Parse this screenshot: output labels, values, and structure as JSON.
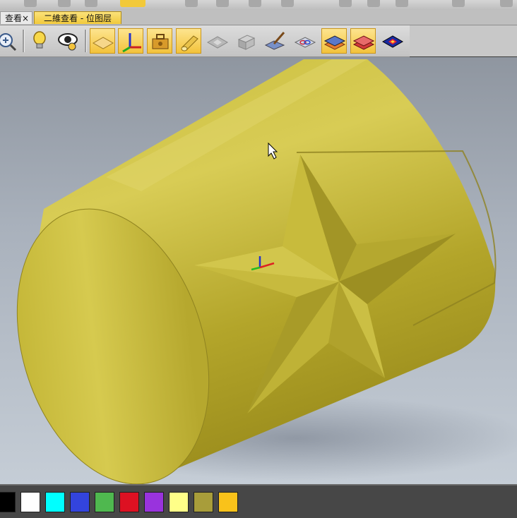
{
  "tabs": [
    {
      "label": "查看",
      "close": "×",
      "active": false
    },
    {
      "label": "二維查看 - 位图层",
      "active": true
    }
  ],
  "toolbar": {
    "icons": [
      {
        "name": "zoom-icon",
        "active": false
      },
      {
        "name": "lightbulb-icon",
        "active": false
      },
      {
        "name": "eye-icon",
        "active": false
      },
      {
        "name": "plane-icon",
        "active": true
      },
      {
        "name": "axes-icon",
        "active": true
      },
      {
        "name": "toolbox-icon",
        "active": true
      },
      {
        "name": "cylinder-icon",
        "active": true
      },
      {
        "name": "relief-grey-icon",
        "active": false
      },
      {
        "name": "relief-cube-grey-icon",
        "active": false
      },
      {
        "name": "brush-icon",
        "active": false
      },
      {
        "name": "blend-layers-icon",
        "active": false
      },
      {
        "name": "layer-blue-orange-icon",
        "active": true
      },
      {
        "name": "layer-red-icon",
        "active": true
      },
      {
        "name": "layer-diamond-icon",
        "active": false
      }
    ]
  },
  "viewport": {
    "model_color": "#b8ab2e",
    "background_top": "#8f96a0",
    "background_bottom": "#c5cdd6"
  },
  "palette": {
    "colors": [
      "#000000",
      "#ffffff",
      "#00ffff",
      "#3344dd",
      "#4fb84f",
      "#dd1122",
      "#9933dd",
      "#ffff88",
      "#a89d3a",
      "#f9c21a"
    ]
  }
}
